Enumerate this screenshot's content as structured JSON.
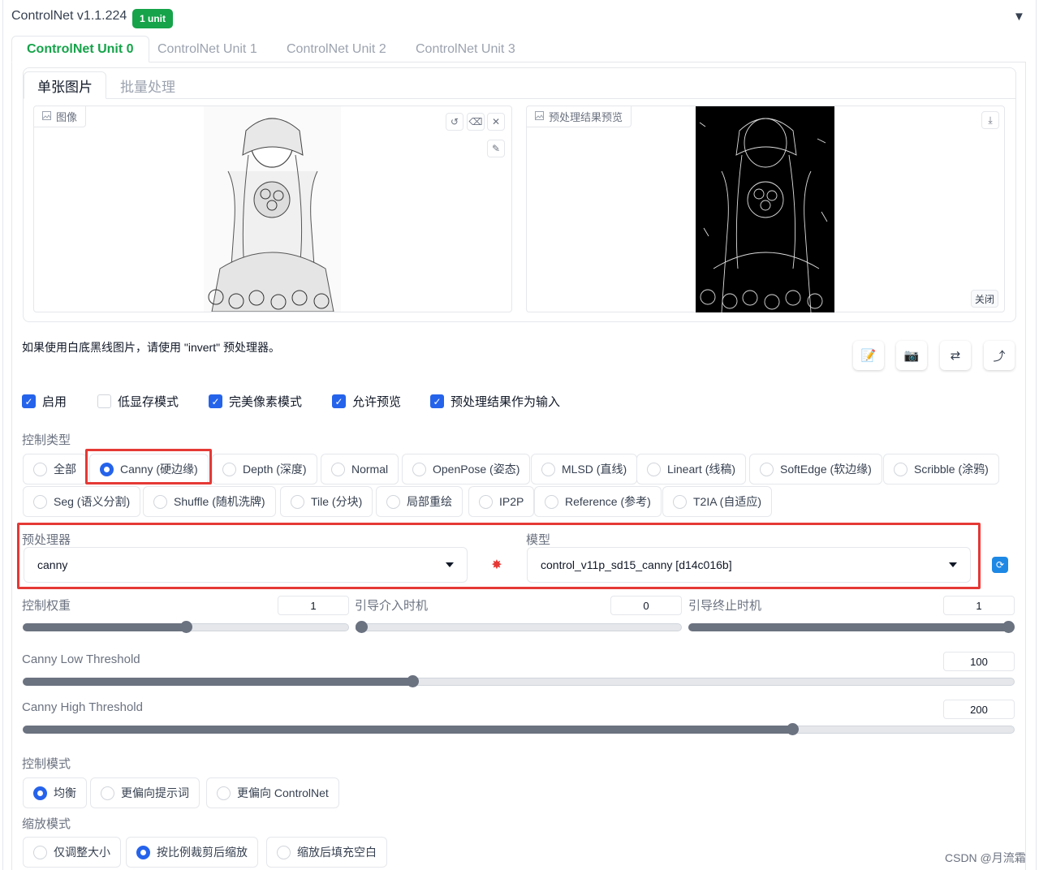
{
  "header": {
    "title": "ControlNet v1.1.224",
    "badge": "1 unit",
    "collapse_icon": "▼"
  },
  "tabs": [
    "ControlNet Unit 0",
    "ControlNet Unit 1",
    "ControlNet Unit 2",
    "ControlNet Unit 3"
  ],
  "subtabs": [
    "单张图片",
    "批量处理"
  ],
  "image_panel": {
    "label": "图像"
  },
  "preview_panel": {
    "label": "预处理结果预览",
    "close": "关闭"
  },
  "note": "如果使用白底黑线图片，请使用 \"invert\" 预处理器。",
  "toolbar_icons": [
    "edit-icon",
    "camera-icon",
    "swap-icon",
    "arrow-icon"
  ],
  "checkboxes": [
    {
      "label": "启用",
      "checked": true
    },
    {
      "label": "低显存模式",
      "checked": false
    },
    {
      "label": "完美像素模式",
      "checked": true
    },
    {
      "label": "允许预览",
      "checked": true
    },
    {
      "label": "预处理结果作为输入",
      "checked": true
    }
  ],
  "control_type": {
    "title": "控制类型",
    "row1": [
      "全部",
      "Canny (硬边缘)",
      "Depth (深度)",
      "Normal",
      "OpenPose (姿态)",
      "MLSD (直线)",
      "Lineart (线稿)",
      "SoftEdge (软边缘)",
      "Scribble (涂鸦)"
    ],
    "row2": [
      "Seg (语义分割)",
      "Shuffle (随机洗牌)",
      "Tile (分块)",
      "局部重绘",
      "IP2P",
      "Reference (参考)",
      "T2IA (自适应)"
    ],
    "selected": "Canny (硬边缘)"
  },
  "preprocessor": {
    "title": "预处理器",
    "value": "canny"
  },
  "model": {
    "title": "模型",
    "value": "control_v11p_sd15_canny [d14c016b]"
  },
  "sliders": {
    "weight": {
      "label": "控制权重",
      "value": "1",
      "fraction": 0.5
    },
    "start": {
      "label": "引导介入时机",
      "value": "0",
      "fraction": 0.0
    },
    "end": {
      "label": "引导终止时机",
      "value": "1",
      "fraction": 1.0
    },
    "low": {
      "label": "Canny Low Threshold",
      "value": "100",
      "fraction": 0.392
    },
    "high": {
      "label": "Canny High Threshold",
      "value": "200",
      "fraction": 0.78
    }
  },
  "control_mode": {
    "title": "控制模式",
    "options": [
      "均衡",
      "更偏向提示词",
      "更偏向 ControlNet"
    ],
    "selected": "均衡"
  },
  "resize_mode": {
    "title": "缩放模式",
    "options": [
      "仅调整大小",
      "按比例裁剪后缩放",
      "缩放后填充空白"
    ],
    "selected": "按比例裁剪后缩放"
  },
  "watermark": "CSDN @月流霜"
}
